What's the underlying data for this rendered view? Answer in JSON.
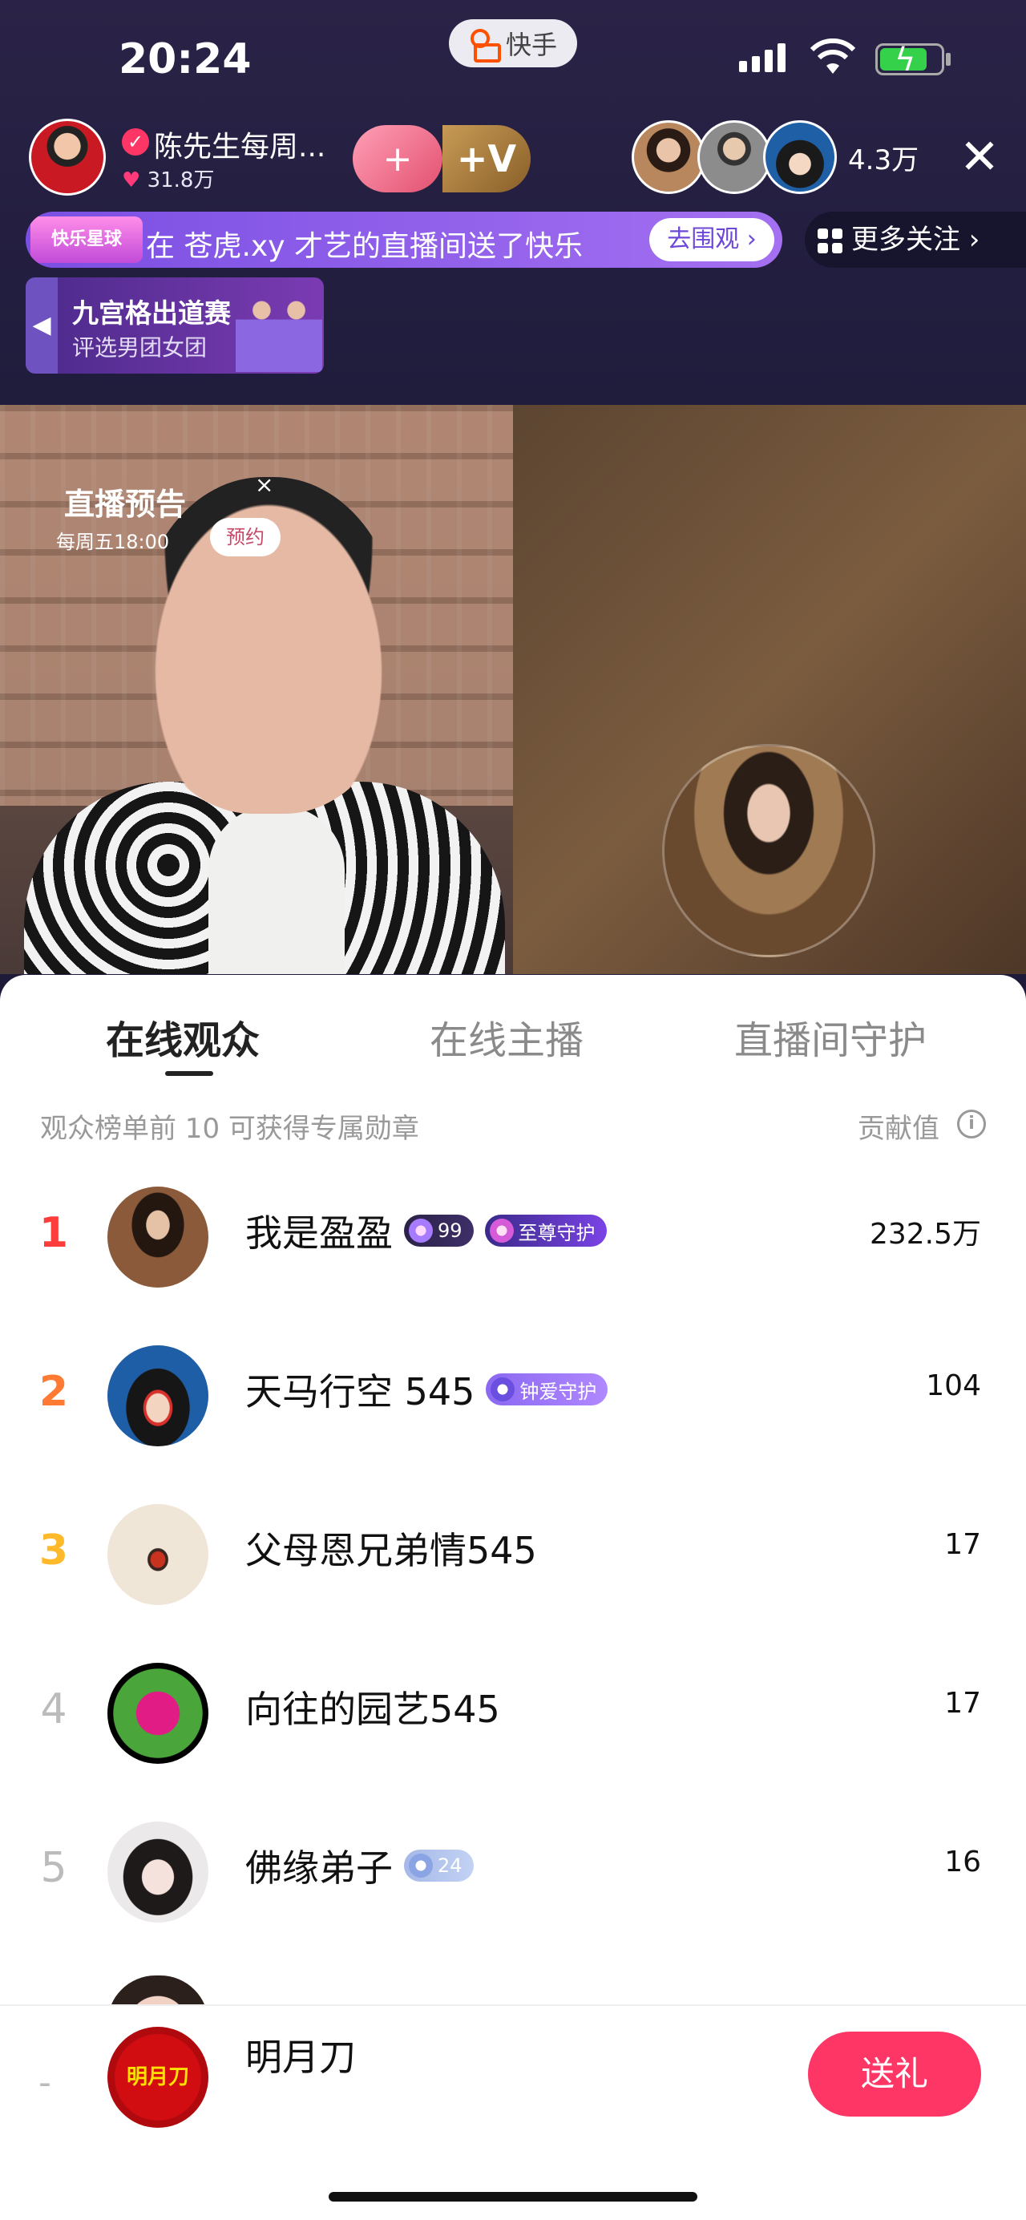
{
  "status_bar": {
    "time": "20:24",
    "app_name": "快手"
  },
  "host": {
    "name": "陈先生每周...",
    "likes": "31.8万"
  },
  "follow": {
    "plus": "+",
    "v_label": "+V"
  },
  "viewers": {
    "count": "4.3万"
  },
  "banner": {
    "tag": "快乐星球",
    "text": "在 苍虎.xy 才艺的直播间送了快乐",
    "button": "去围观 ›"
  },
  "more_follow": {
    "label": "更多关注 ›"
  },
  "promo": {
    "title": "九宫格出道赛",
    "subtitle": "评选男团女团"
  },
  "stream_preview": {
    "title": "直播预告",
    "schedule": "每周五18:00",
    "button": "预约",
    "close": "×"
  },
  "sheet": {
    "tabs": [
      "在线观众",
      "在线主播",
      "直播间守护"
    ],
    "hint": "观众榜单前 10 可获得专属勋章",
    "contribution_label": "贡献值",
    "rows": [
      {
        "rank": "1",
        "name": "我是盈盈",
        "badges": [
          "99",
          "至尊守护"
        ],
        "score": "232.5万"
      },
      {
        "rank": "2",
        "name": "天马行空 545",
        "badges": [
          "钟爱守护"
        ],
        "score": "104"
      },
      {
        "rank": "3",
        "name": "父母恩兄弟情545",
        "badges": [],
        "score": "17"
      },
      {
        "rank": "4",
        "name": "向往的园艺545",
        "badges": [],
        "score": "17"
      },
      {
        "rank": "5",
        "name": "佛缘弟子",
        "badges": [
          "24"
        ],
        "score": "16"
      }
    ]
  },
  "me": {
    "rank": "-",
    "avatar_text": "明月刀",
    "name": "明月刀",
    "gift_button": "送礼"
  },
  "colors": {
    "accent": "#fe3666",
    "rank1": "#fd3c3c",
    "rank2": "#ff7a32",
    "rank3": "#ffb92b",
    "banner": "#7b4fe3"
  }
}
